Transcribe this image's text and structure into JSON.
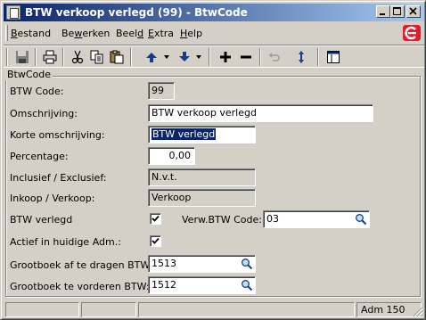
{
  "window": {
    "title": "BTW verkoop verlegd (99) - BtwCode"
  },
  "menu": {
    "items": [
      "Bestand",
      "Bewerken",
      "Beeld",
      "Extra",
      "Help"
    ]
  },
  "toolbar": {
    "icons": [
      "save-icon",
      "print-icon",
      "cut-icon",
      "copy-icon",
      "paste-icon",
      "arrow-up-icon",
      "arrow-down-icon",
      "plus-icon",
      "minus-icon",
      "undo-icon",
      "refresh-icon",
      "window-icon"
    ]
  },
  "group": {
    "legend": "BtwCode"
  },
  "form": {
    "btw_code_label": "BTW Code:",
    "btw_code_value": "99",
    "omschrijving_label": "Omschrijving:",
    "omschrijving_value": "BTW verkoop verlegd",
    "korte_label": "Korte omschrijving:",
    "korte_value": "BTW verlegd",
    "percentage_label": "Percentage:",
    "percentage_value": "0,00",
    "inclusief_label": "Inclusief / Exclusief:",
    "inclusief_value": "N.v.t.",
    "inkoop_label": "Inkoop / Verkoop:",
    "inkoop_value": "Verkoop",
    "verlegd_label": "BTW verlegd",
    "verlegd_checked": true,
    "verw_label": "Verw.BTW Code:",
    "verw_value": "03",
    "actief_label": "Actief in huidige Adm.:",
    "actief_checked": true,
    "gb_af_label": "Grootboek af te dragen BTW:",
    "gb_af_value": "1513",
    "gb_te_label": "Grootboek te vorderen BTW:",
    "gb_te_value": "1512"
  },
  "status": {
    "admin": "Adm 150"
  },
  "colors": {
    "title_start": "#0a246a",
    "title_end": "#a6caf0",
    "face": "#d4d0c8",
    "selection": "#0a246a",
    "logo": "#e8192c"
  }
}
